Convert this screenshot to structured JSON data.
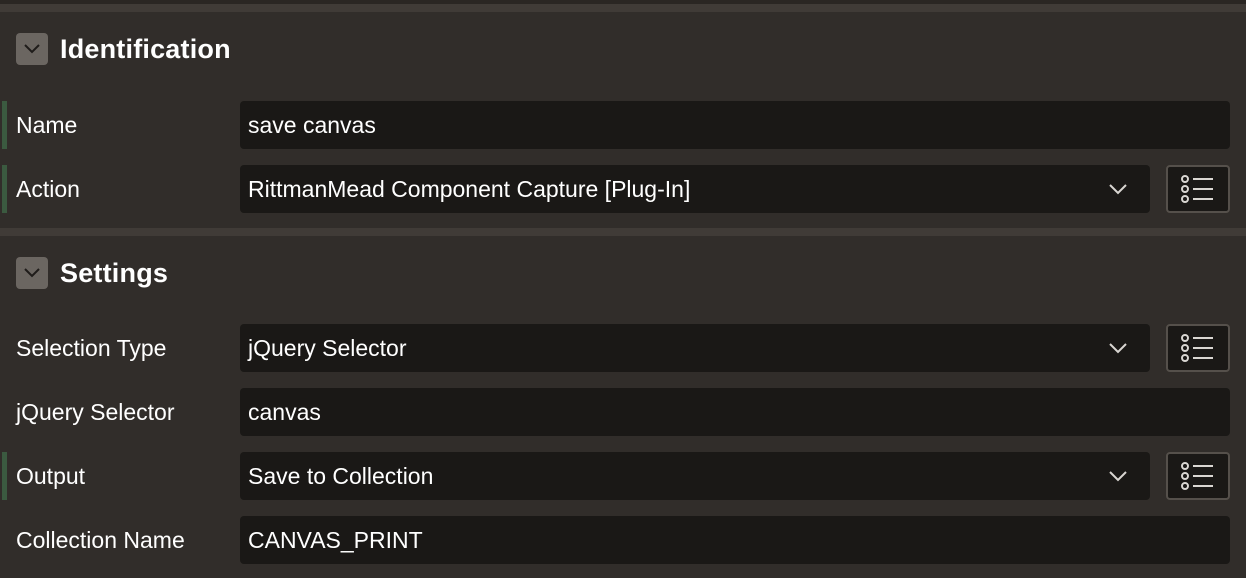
{
  "sections": [
    {
      "title": "Identification",
      "expanded": true,
      "rows": [
        {
          "label": "Name",
          "value": "save canvas",
          "type": "text",
          "required": true
        },
        {
          "label": "Action",
          "value": "RittmanMead Component Capture [Plug-In]",
          "type": "select",
          "required": true,
          "has_lov": true
        }
      ]
    },
    {
      "title": "Settings",
      "expanded": true,
      "rows": [
        {
          "label": "Selection Type",
          "value": "jQuery Selector",
          "type": "select",
          "required": false,
          "has_lov": true
        },
        {
          "label": "jQuery Selector",
          "value": "canvas",
          "type": "text",
          "required": false
        },
        {
          "label": "Output",
          "value": "Save to Collection",
          "type": "select",
          "required": true,
          "has_lov": true
        },
        {
          "label": "Collection Name",
          "value": "CANVAS_PRINT",
          "type": "text",
          "required": false
        }
      ]
    }
  ],
  "icons": {
    "collapse": "chevron-down-icon",
    "select": "chevron-down-icon",
    "lov": "list-icon"
  },
  "colors": {
    "background": "#312d2a",
    "field_bg": "#1a1816",
    "required_indicator": "#3b5a40",
    "collapse_button": "#6b6661"
  }
}
